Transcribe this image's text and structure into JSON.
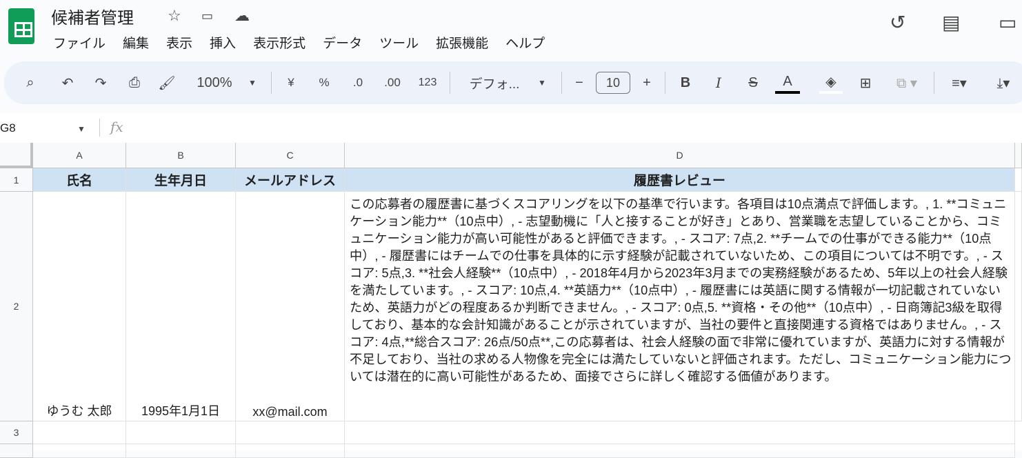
{
  "app": {
    "title": "候補者管理",
    "menu": [
      "ファイル",
      "編集",
      "表示",
      "挿入",
      "表示形式",
      "データ",
      "ツール",
      "拡張機能",
      "ヘルプ"
    ]
  },
  "toolbar": {
    "zoom": "100%",
    "currency": "¥",
    "percent": "%",
    "dec_less": ".0",
    "dec_more": ".00",
    "number_format": "123",
    "font": "デフォ...",
    "font_size": "10",
    "bold": "B",
    "italic": "I",
    "text_color": "A"
  },
  "formula_bar": {
    "cell_ref": "G8",
    "fx": "fx",
    "value": ""
  },
  "sheet": {
    "columns": [
      "A",
      "B",
      "C",
      "D"
    ],
    "rows": [
      "1",
      "2",
      "3"
    ],
    "headers": [
      "氏名",
      "生年月日",
      "メールアドレス",
      "履歴書レビュー"
    ],
    "data": [
      {
        "name": "ゆうむ 太郎",
        "birthdate": "1995年1月1日",
        "email": "xx@mail.com",
        "review": "この応募者の履歴書に基づくスコアリングを以下の基準で行います。各項目は10点満点で評価します。, 1. **コミュニケーション能力**（10点中）, - 志望動機に「人と接することが好き」とあり、営業職を志望していることから、コミュニケーション能力が高い可能性があると評価できます。, - スコア: 7点,2. **チームでの仕事ができる能力**（10点中）, - 履歴書にはチームでの仕事を具体的に示す経験が記載されていないため、この項目については不明です。, - スコア: 5点,3. **社会人経験**（10点中）, - 2018年4月から2023年3月までの実務経験があるため、5年以上の社会人経験を満たしています。, - スコア: 10点,4. **英語力**（10点中）, - 履歴書には英語に関する情報が一切記載されていないため、英語力がどの程度あるか判断できません。, - スコア: 0点,5. **資格・その他**（10点中）, - 日商簿記3級を取得しており、基本的な会計知識があることが示されていますが、当社の要件と直接関連する資格ではありません。, - スコア: 4点,**総合スコア: 26点/50点**,この応募者は、社会人経験の面で非常に優れていますが、英語力に対する情報が不足しており、当社の求める人物像を完全には満たしていないと評価されます。ただし、コミュニケーション能力については潜在的に高い可能性があるため、面接でさらに詳しく確認する価値があります。"
      }
    ]
  }
}
